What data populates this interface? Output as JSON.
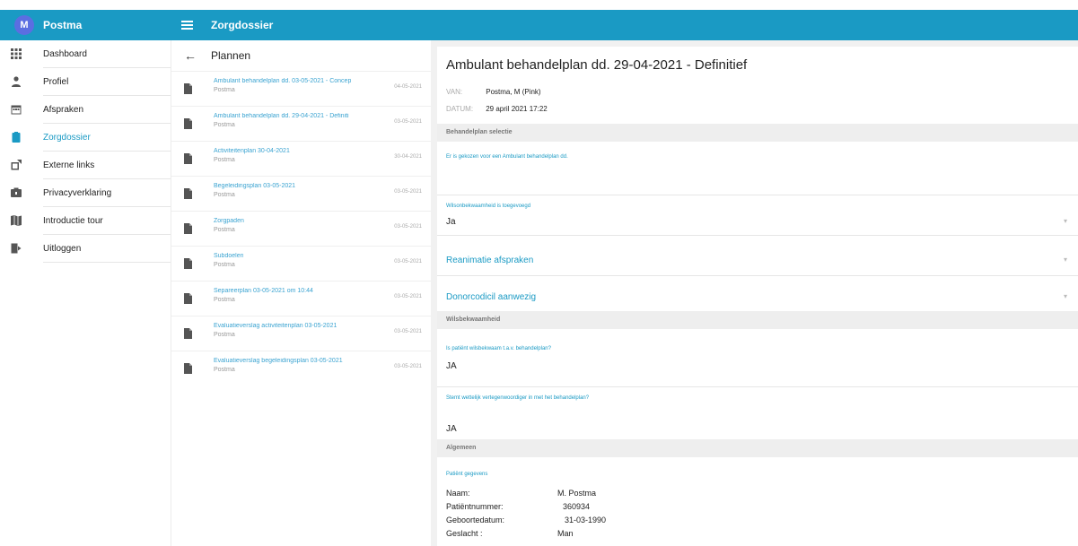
{
  "header": {
    "avatar_letter": "M",
    "app_name": "Postma",
    "section_title": "Zorgdossier",
    "menu_icon": "hamburger-icon",
    "color": "#1a9ac4"
  },
  "sidebar": {
    "items": [
      {
        "label": "Dashboard",
        "icon": "grid-icon"
      },
      {
        "label": "Profiel",
        "icon": "person-icon"
      },
      {
        "label": "Afspraken",
        "icon": "calendar-icon"
      },
      {
        "label": "Zorgdossier",
        "icon": "clipboard-icon",
        "active": true
      },
      {
        "label": "Externe links",
        "icon": "external-link-icon"
      },
      {
        "label": "Privacyverklaring",
        "icon": "shield-icon"
      },
      {
        "label": "Introductie tour",
        "icon": "map-icon"
      },
      {
        "label": "Uitloggen",
        "icon": "logout-icon"
      }
    ]
  },
  "list": {
    "title": "Plannen",
    "items": [
      {
        "title": "Ambulant behandelplan dd. 03-05-2021 - Concep",
        "sub": "Postma",
        "date": "04-05-2021"
      },
      {
        "title": "Ambulant behandelplan dd. 29-04-2021 - Definiti",
        "sub": "Postma",
        "date": "03-05-2021"
      },
      {
        "title": "Activiteitenplan 30-04-2021",
        "sub": "Postma",
        "date": "30-04-2021"
      },
      {
        "title": "Begeleidingsplan 03-05-2021",
        "sub": "Postma",
        "date": "03-05-2021"
      },
      {
        "title": "Zorgpaden",
        "sub": "Postma",
        "date": "03-05-2021"
      },
      {
        "title": "Subdoelen",
        "sub": "Postma",
        "date": "03-05-2021"
      },
      {
        "title": "Separeerplan 03-05-2021 om 10:44",
        "sub": "Postma",
        "date": "03-05-2021"
      },
      {
        "title": "Evaluatieverslag activiteitenplan 03-05-2021",
        "sub": "Postma",
        "date": "03-05-2021"
      },
      {
        "title": "Evaluatieverslag begeleidingsplan 03-05-2021",
        "sub": "Postma",
        "date": "03-05-2021"
      }
    ]
  },
  "detail": {
    "title": "Ambulant behandelplan dd. 29-04-2021 - Definitief",
    "van_label": "VAN:",
    "van_value": "Postma, M (Pink)",
    "datum_label": "DATUM:",
    "datum_value": "29 april 2021 17:22",
    "section1": "Behandelplan selectie",
    "choice_text": "Er is gekozen voor een Ambulant behandelplan dd.",
    "wils_label": "Wilsonbekwaamheid is toegevoegd",
    "wils_value": "Ja",
    "reanimatie": "Reanimatie afspraken",
    "donor": "Donorcodicil aanwezig",
    "section2": "Wilsbekwaamheid",
    "q1": "Is patiënt wilsbekwaam t.a.v. behandelplan?",
    "a1": "JA",
    "q2": "Stemt wettelijk vertegenwoordiger in met het behandelplan?",
    "a2": "JA",
    "section3": "Algemeen",
    "patient_label": "Patiënt gegevens",
    "patient": [
      {
        "k": "Naam:",
        "v": "M. Postma"
      },
      {
        "k": "Patiëntnummer:",
        "v": "360934"
      },
      {
        "k": "Geboortedatum:",
        "v": "31-03-1990"
      },
      {
        "k": "Geslacht :",
        "v": "Man"
      }
    ]
  }
}
